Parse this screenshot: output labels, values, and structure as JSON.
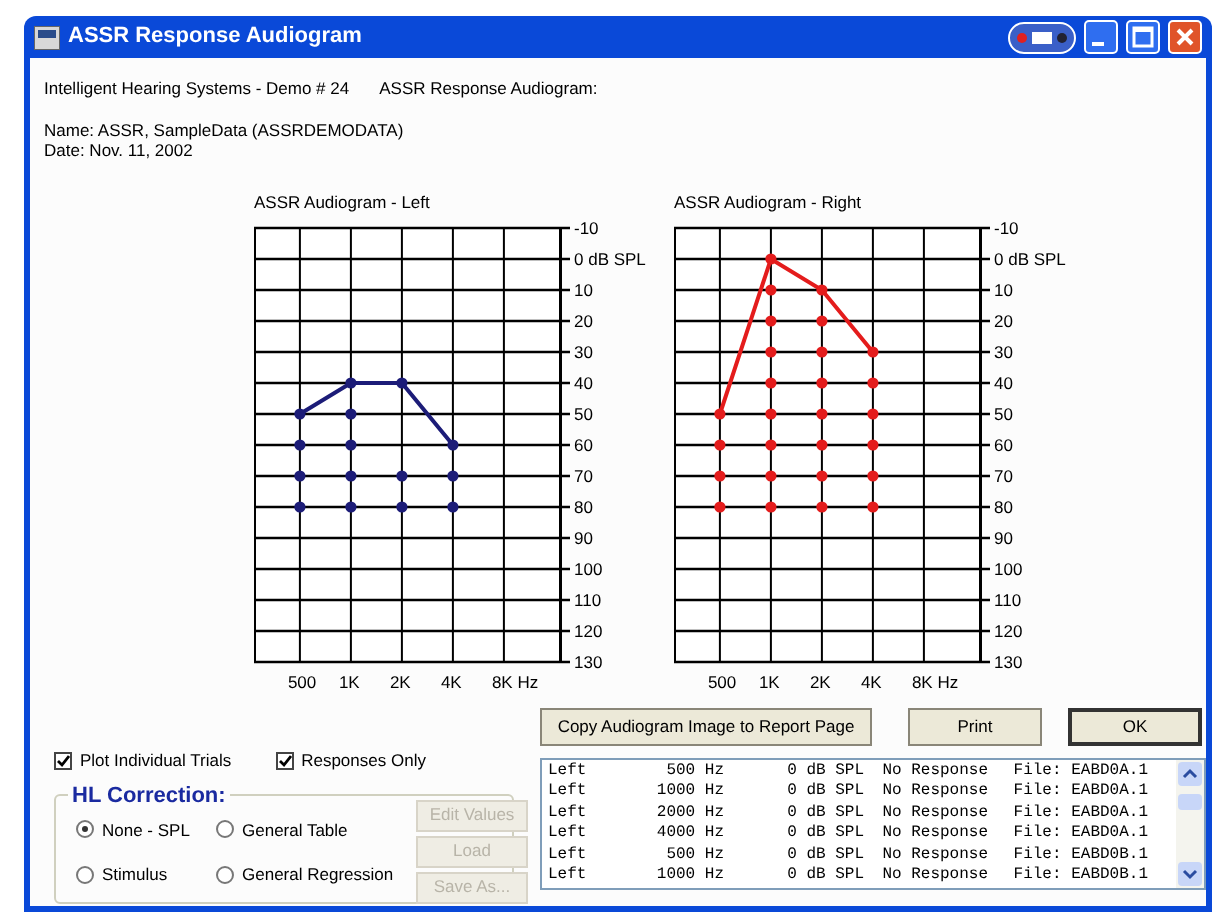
{
  "window": {
    "title": "ASSR Response Audiogram"
  },
  "header": {
    "system": "Intelligent Hearing Systems - Demo # 24",
    "report": "ASSR Response Audiogram:",
    "name": "Name: ASSR, SampleData  (ASSRDEMODATA)",
    "date": "Date: Nov. 11, 2002"
  },
  "charts": [
    {
      "chart_data": {
        "type": "line",
        "grid": true,
        "title": "ASSR Audiogram - Left",
        "categories": [
          "500",
          "1K",
          "2K",
          "4K",
          "8K Hz"
        ],
        "ylim": [
          130,
          -10
        ],
        "yticks": [
          {
            "value": -10,
            "label": "-10"
          },
          {
            "value": 0,
            "label": "0 dB SPL"
          },
          {
            "value": 10,
            "label": "10"
          },
          {
            "value": 20,
            "label": "20"
          },
          {
            "value": 30,
            "label": "30"
          },
          {
            "value": 40,
            "label": "40"
          },
          {
            "value": 50,
            "label": "50"
          },
          {
            "value": 60,
            "label": "60"
          },
          {
            "value": 70,
            "label": "70"
          },
          {
            "value": 80,
            "label": "80"
          },
          {
            "value": 90,
            "label": "90"
          },
          {
            "value": 100,
            "label": "100"
          },
          {
            "value": 110,
            "label": "110"
          },
          {
            "value": 120,
            "label": "120"
          },
          {
            "value": 130,
            "label": "130"
          }
        ],
        "series": [
          {
            "type": "line",
            "marker": "circle",
            "color": "#1c1c78",
            "values": [
              50,
              40,
              40,
              60,
              null
            ]
          },
          {
            "type": "scatter",
            "color": "#1c1c78",
            "values": [
              null,
              50,
              null,
              null,
              null
            ]
          },
          {
            "type": "scatter",
            "color": "#1c1c78",
            "values": [
              60,
              60,
              null,
              null,
              null
            ]
          },
          {
            "type": "scatter",
            "color": "#1c1c78",
            "values": [
              70,
              70,
              70,
              70,
              null
            ]
          },
          {
            "type": "scatter",
            "color": "#1c1c78",
            "values": [
              80,
              80,
              80,
              80,
              null
            ]
          }
        ]
      }
    },
    {
      "chart_data": {
        "type": "line",
        "grid": true,
        "title": "ASSR Audiogram - Right",
        "categories": [
          "500",
          "1K",
          "2K",
          "4K",
          "8K Hz"
        ],
        "ylim": [
          130,
          -10
        ],
        "yticks": [
          {
            "value": -10,
            "label": "-10"
          },
          {
            "value": 0,
            "label": "0 dB SPL"
          },
          {
            "value": 10,
            "label": "10"
          },
          {
            "value": 20,
            "label": "20"
          },
          {
            "value": 30,
            "label": "30"
          },
          {
            "value": 40,
            "label": "40"
          },
          {
            "value": 50,
            "label": "50"
          },
          {
            "value": 60,
            "label": "60"
          },
          {
            "value": 70,
            "label": "70"
          },
          {
            "value": 80,
            "label": "80"
          },
          {
            "value": 90,
            "label": "90"
          },
          {
            "value": 100,
            "label": "100"
          },
          {
            "value": 110,
            "label": "110"
          },
          {
            "value": 120,
            "label": "120"
          },
          {
            "value": 130,
            "label": "130"
          }
        ],
        "series": [
          {
            "type": "line",
            "marker": "circle",
            "color": "#e41c1c",
            "values": [
              50,
              0,
              10,
              30,
              null
            ]
          },
          {
            "type": "scatter",
            "color": "#e41c1c",
            "values": [
              null,
              10,
              null,
              null,
              null
            ]
          },
          {
            "type": "scatter",
            "color": "#e41c1c",
            "values": [
              null,
              20,
              20,
              null,
              null
            ]
          },
          {
            "type": "scatter",
            "color": "#e41c1c",
            "values": [
              null,
              30,
              30,
              null,
              null
            ]
          },
          {
            "type": "scatter",
            "color": "#e41c1c",
            "values": [
              null,
              40,
              40,
              40,
              null
            ]
          },
          {
            "type": "scatter",
            "color": "#e41c1c",
            "values": [
              null,
              50,
              50,
              50,
              null
            ]
          },
          {
            "type": "scatter",
            "color": "#e41c1c",
            "values": [
              60,
              60,
              60,
              60,
              null
            ]
          },
          {
            "type": "scatter",
            "color": "#e41c1c",
            "values": [
              70,
              70,
              70,
              70,
              null
            ]
          },
          {
            "type": "scatter",
            "color": "#e41c1c",
            "values": [
              80,
              80,
              80,
              80,
              null
            ]
          }
        ]
      }
    }
  ],
  "options": [
    {
      "label": "Plot Individual Trials",
      "checked": true
    },
    {
      "label": "Responses Only",
      "checked": true
    }
  ],
  "hl_correction": {
    "title": "HL Correction:",
    "choices": [
      {
        "label": "None - SPL",
        "selected": true
      },
      {
        "label": "General Table",
        "selected": false
      },
      {
        "label": "Stimulus",
        "selected": false
      },
      {
        "label": "General Regression",
        "selected": false
      }
    ],
    "buttons": [
      {
        "label": "Edit Values",
        "disabled": true
      },
      {
        "label": "Load",
        "disabled": true
      },
      {
        "label": "Save As...",
        "disabled": true
      }
    ]
  },
  "actions": [
    {
      "label": "Copy Audiogram Image to Report Page",
      "default": false
    },
    {
      "label": "Print",
      "default": false
    },
    {
      "label": "OK",
      "default": true
    }
  ],
  "results": [
    {
      "side": "Left",
      "frequency": "500 Hz",
      "level": "0 dB SPL",
      "result": "No Response",
      "file": "File: EABD0A.1"
    },
    {
      "side": "Left",
      "frequency": "1000 Hz",
      "level": "0 dB SPL",
      "result": "No Response",
      "file": "File: EABD0A.1"
    },
    {
      "side": "Left",
      "frequency": "2000 Hz",
      "level": "0 dB SPL",
      "result": "No Response",
      "file": "File: EABD0A.1"
    },
    {
      "side": "Left",
      "frequency": "4000 Hz",
      "level": "0 dB SPL",
      "result": "No Response",
      "file": "File: EABD0A.1"
    },
    {
      "side": "Left",
      "frequency": "500 Hz",
      "level": "0 dB SPL",
      "result": "No Response",
      "file": "File: EABD0B.1"
    },
    {
      "side": "Left",
      "frequency": "1000 Hz",
      "level": "0 dB SPL",
      "result": "No Response",
      "file": "File: EABD0B.1"
    }
  ]
}
